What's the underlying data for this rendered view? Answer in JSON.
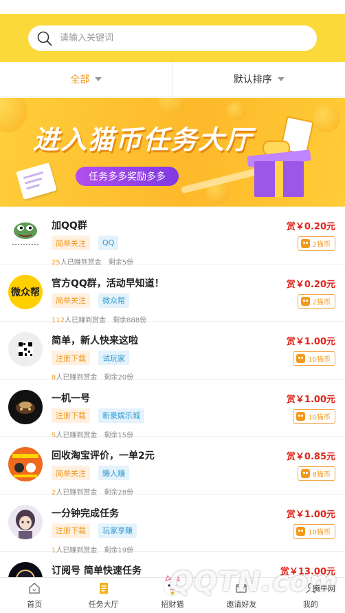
{
  "search": {
    "placeholder": "请输入关键词"
  },
  "filters": {
    "category": "全部",
    "sort": "默认排序"
  },
  "banner": {
    "title": "进入猫币任务大厅",
    "slogan": "任务多多奖励多多"
  },
  "tasks": [
    {
      "title": "加QQ群",
      "tags": [
        "简单关注",
        "QQ"
      ],
      "count": "25",
      "earned_label": "人已赚到赏金",
      "remaining": "剩余5份",
      "reward": "赏￥0.20元",
      "coins": "2猫币",
      "avatar": "frog"
    },
    {
      "title": "官方QQ群，活动早知道！",
      "tags": [
        "简单关注",
        "微众帮"
      ],
      "count": "112",
      "earned_label": "人已赚到赏金",
      "remaining": "剩余888份",
      "reward": "赏￥0.20元",
      "coins": "2猫币",
      "avatar": "weizhongbang",
      "avatar_text": "微众帮"
    },
    {
      "title": "简单，新人快来这啦",
      "tags": [
        "注册下载",
        "试玩家"
      ],
      "count": "8",
      "earned_label": "人已赚到赏金",
      "remaining": "剩余20份",
      "reward": "赏￥1.00元",
      "coins": "10猫币",
      "avatar": "qrcode"
    },
    {
      "title": "一机一号",
      "tags": [
        "注册下载",
        "新豪娱乐城"
      ],
      "count": "5",
      "earned_label": "人已赚到赏金",
      "remaining": "剩余15份",
      "reward": "赏￥1.00元",
      "coins": "10猫币",
      "avatar": "dark"
    },
    {
      "title": "回收淘宝评价，一单2元",
      "tags": [
        "简单关注",
        "懒人赚"
      ],
      "count": "2",
      "earned_label": "人已赚到赏金",
      "remaining": "剩余28份",
      "reward": "赏￥0.85元",
      "coins": "8猫币",
      "avatar": "orange"
    },
    {
      "title": "一分钟完成任务",
      "tags": [
        "注册下载",
        "玩家享赚"
      ],
      "count": "1",
      "earned_label": "人已赚到赏金",
      "remaining": "剩余19份",
      "reward": "赏￥1.00元",
      "coins": "10猫币",
      "avatar": "anime"
    },
    {
      "title": "订阅号 简单快速任务",
      "reward": "赏￥13.00元",
      "avatar": "eclipse"
    }
  ],
  "nav": {
    "home": "首页",
    "hall": "任务大厅",
    "cat": "招财猫",
    "invite": "邀请好友",
    "mine": "我的"
  },
  "watermark": {
    "main": "QQTN.com",
    "sub": "腾牛网"
  },
  "colors": {
    "brand_yellow": "#fbd93b",
    "accent_orange": "#f39a1e",
    "reward_red": "#e0251a",
    "tag_blue": "#2d9ad6"
  }
}
